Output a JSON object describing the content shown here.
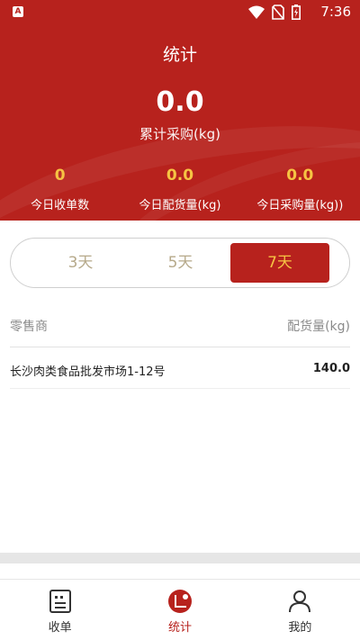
{
  "status": {
    "time": "7:36",
    "notif_letter": "A"
  },
  "header": {
    "title": "统计",
    "total_value": "0.0",
    "total_label": "累计采购(kg)",
    "stats": [
      {
        "value": "0",
        "label": "今日收单数"
      },
      {
        "value": "0.0",
        "label": "今日配货量(kg)"
      },
      {
        "value": "0.0",
        "label": "今日采购量(kg))"
      }
    ]
  },
  "range": {
    "options": [
      "3天",
      "5天",
      "7天"
    ],
    "selected": "7天"
  },
  "table": {
    "columns": [
      "零售商",
      "配货量(kg)"
    ],
    "rows": [
      {
        "name": "长沙肉类食品批发市场1-12号",
        "amount": "140.0"
      }
    ]
  },
  "tabbar": {
    "items": [
      {
        "label": "收单",
        "icon": "list-icon"
      },
      {
        "label": "统计",
        "icon": "chart-icon"
      },
      {
        "label": "我的",
        "icon": "user-icon"
      }
    ],
    "active": "统计"
  },
  "colors": {
    "primary": "#b7221d",
    "accent": "#f6c343"
  }
}
